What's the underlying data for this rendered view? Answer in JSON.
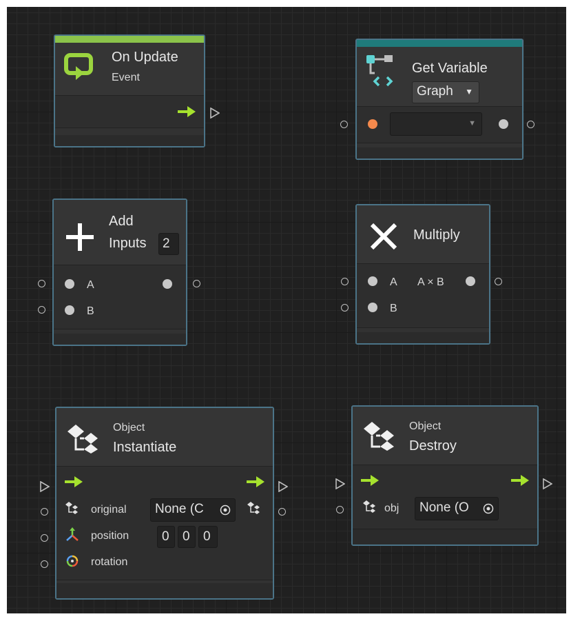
{
  "nodes": {
    "on_update": {
      "title": "On Update",
      "subtitle": "Event",
      "accent": "#8bc34a"
    },
    "get_variable": {
      "title": "Get Variable",
      "kind": "Graph",
      "accent": "#1f7b7b"
    },
    "add": {
      "title": "Add",
      "inputs_label": "Inputs",
      "inputs_value": "2",
      "port_a": "A",
      "port_b": "B"
    },
    "multiply": {
      "title": "Multiply",
      "port_a": "A",
      "port_b": "B",
      "output": "A × B"
    },
    "instantiate": {
      "category": "Object",
      "title": "Instantiate",
      "original_label": "original",
      "original_value": "None (C",
      "position_label": "position",
      "position_values": [
        "0",
        "0",
        "0"
      ],
      "rotation_label": "rotation"
    },
    "destroy": {
      "category": "Object",
      "title": "Destroy",
      "obj_label": "obj",
      "obj_value": "None (O"
    }
  },
  "colors": {
    "canvas": "#202020",
    "node_border": "#4b7488",
    "flow_arrow": "#a6e22e",
    "orange_dot": "#f4894c"
  },
  "icons": [
    "loop-icon",
    "variable-icon",
    "plus-icon",
    "multiply-icon",
    "gameobject-icon",
    "flow-arrow-icon",
    "target-icon",
    "axis-icon",
    "rotation-icon",
    "dropdown-caret-icon"
  ]
}
